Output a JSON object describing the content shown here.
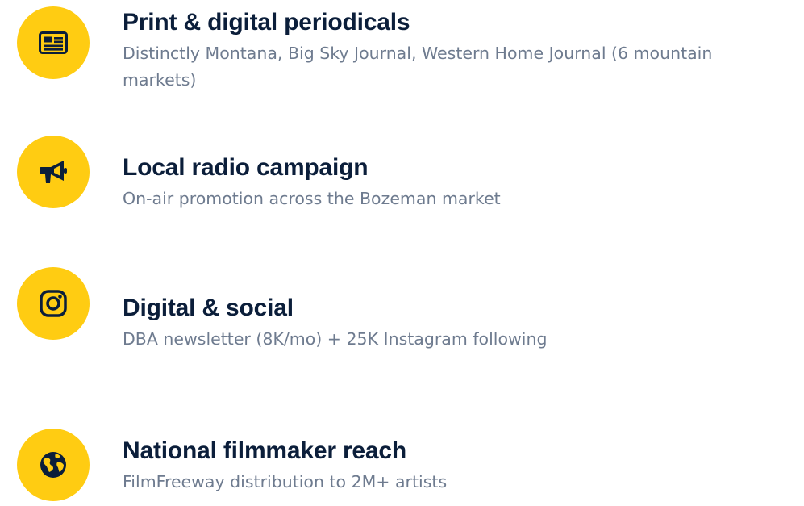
{
  "accent_color": "#FFCC12",
  "title_color": "#0B1E3A",
  "description_color": "#6E7B8F",
  "items": [
    {
      "icon": "newspaper-icon",
      "title": "Print & digital periodicals",
      "description": "Distinctly Montana, Big Sky Journal, Western Home Journal (6 mountain markets)"
    },
    {
      "icon": "megaphone-icon",
      "title": "Local radio campaign",
      "description": "On-air promotion across the Bozeman market"
    },
    {
      "icon": "instagram-icon",
      "title": "Digital & social",
      "description": "DBA newsletter (8K/mo) + 25K Instagram following"
    },
    {
      "icon": "globe-icon",
      "title": "National filmmaker reach",
      "description": "FilmFreeway distribution to 2M+ artists"
    }
  ]
}
